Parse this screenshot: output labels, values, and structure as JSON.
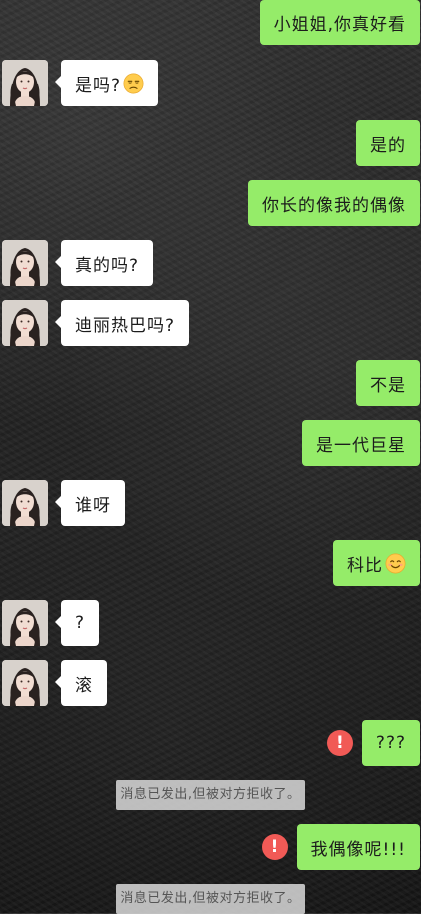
{
  "colors": {
    "outgoing_bubble": "#95ec69",
    "incoming_bubble": "#ffffff",
    "error_badge": "#f15a56",
    "system_notice_bg": "#d4d4d4"
  },
  "contact": {
    "avatar_icon": "girl-portrait-avatar"
  },
  "messages": [
    {
      "side": "right",
      "text": "小姐姐,你真好看"
    },
    {
      "side": "left",
      "text": "是吗?",
      "emoji": "unamused-face"
    },
    {
      "side": "right",
      "text": "是的"
    },
    {
      "side": "right",
      "text": "你长的像我的偶像"
    },
    {
      "side": "left",
      "text": "真的吗?"
    },
    {
      "side": "left",
      "text": "迪丽热巴吗?"
    },
    {
      "side": "right",
      "text": "不是"
    },
    {
      "side": "right",
      "text": "是一代巨星"
    },
    {
      "side": "left",
      "text": "谁呀"
    },
    {
      "side": "right",
      "text": "科比",
      "emoji": "smiling-face"
    },
    {
      "side": "left",
      "text": "?"
    },
    {
      "side": "left",
      "text": "滚"
    },
    {
      "side": "right",
      "text": "???",
      "status_icon": "error-icon"
    },
    {
      "system": true,
      "text": "消息已发出,但被对方拒收了。"
    },
    {
      "side": "right",
      "text": "我偶像呢!!!",
      "status_icon": "error-icon"
    },
    {
      "system": true,
      "text": "消息已发出,但被对方拒收了。"
    }
  ]
}
